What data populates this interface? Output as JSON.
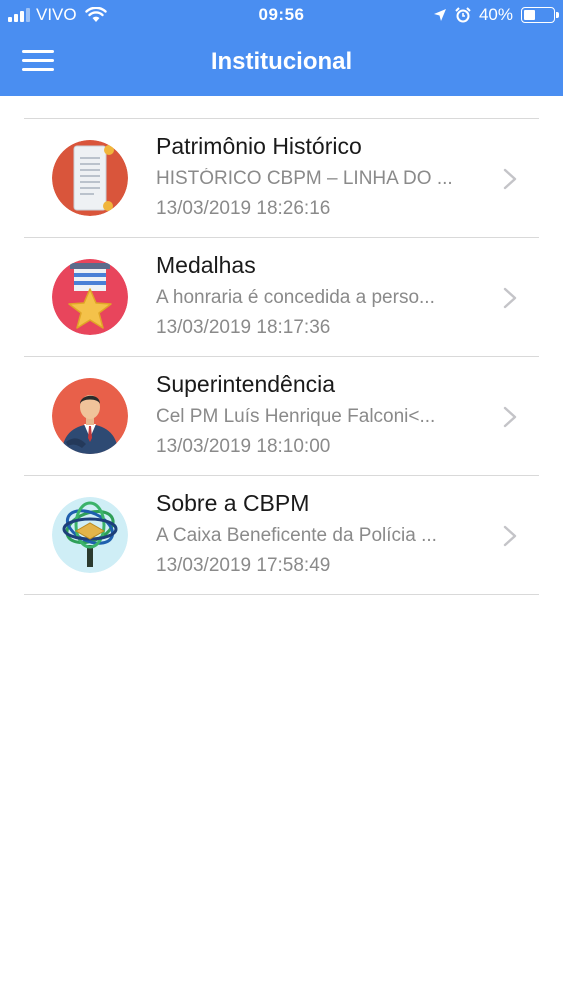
{
  "status_bar": {
    "carrier": "VIVO",
    "time": "09:56",
    "battery": "40%",
    "battery_level": 0.4,
    "icons": [
      "signal-icon",
      "wifi-icon",
      "location-icon",
      "alarm-icon",
      "battery-icon"
    ]
  },
  "header": {
    "title": "Institucional",
    "menu_icon": "hamburger-menu-icon"
  },
  "colors": {
    "appbar": "#4a8ef1",
    "title_text": "#1a1a1a",
    "secondary_text": "#8a8a8a",
    "divider": "#d9d9d9"
  },
  "items": [
    {
      "title": "Patrimônio Histórico",
      "subtitle": "HISTÓRICO CBPM – LINHA DO ...",
      "date": "13/03/2019 18:26:16",
      "icon": "scroll-icon"
    },
    {
      "title": "Medalhas",
      "subtitle": "A honraria é concedida a perso...",
      "date": "13/03/2019 18:17:36",
      "icon": "medal-icon"
    },
    {
      "title": "Superintendência",
      "subtitle": "Cel PM Luís Henrique Falconi<...",
      "date": "13/03/2019 18:10:00",
      "icon": "businessman-icon"
    },
    {
      "title": "Sobre a CBPM",
      "subtitle": "A Caixa Beneficente da Polícia ...",
      "date": "13/03/2019 17:58:49",
      "icon": "cbpm-tree-logo-icon"
    }
  ]
}
